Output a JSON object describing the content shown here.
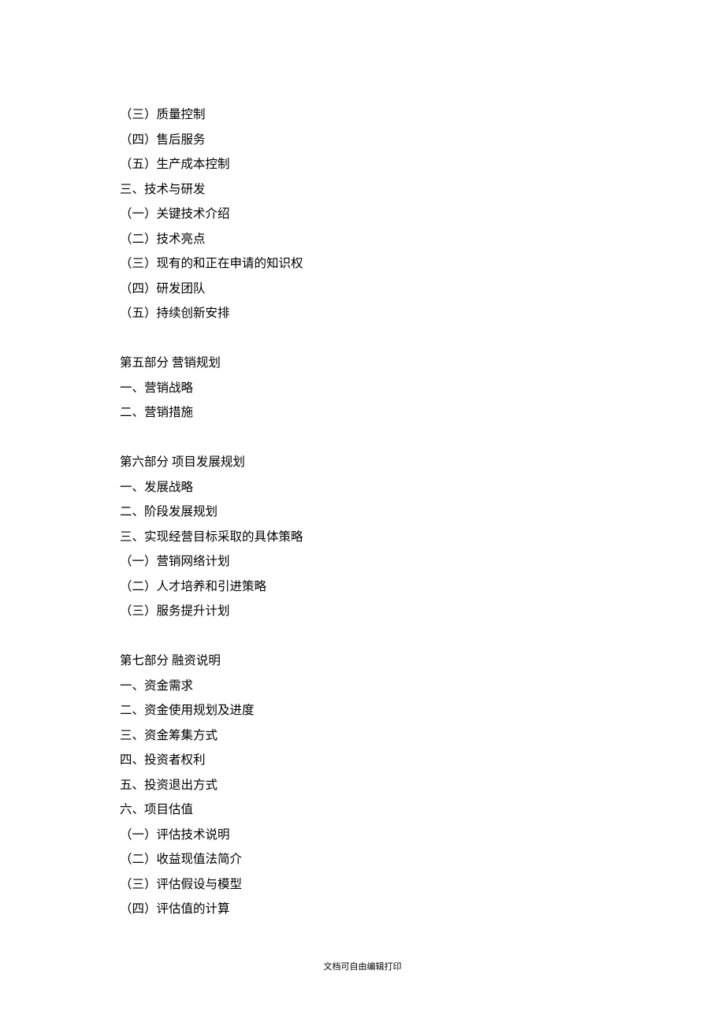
{
  "lines": [
    "（三）质量控制",
    "（四）售后服务",
    "（五）生产成本控制",
    "三、技术与研发",
    "（一）关键技术介绍",
    "（二）技术亮点",
    "（三）现有的和正在申请的知识权",
    "（四）研发团队",
    "（五）持续创新安排",
    "",
    "第五部分  营销规划",
    "一、营销战略",
    "二、营销措施",
    "",
    "第六部分  项目发展规划",
    "一、发展战略",
    "二、阶段发展规划",
    "三、实现经营目标采取的具体策略",
    "（一）营销网络计划",
    "（二）人才培养和引进策略",
    "（三）服务提升计划",
    "",
    "第七部分  融资说明",
    "一、资金需求",
    "二、资金使用规划及进度",
    "三、资金筹集方式",
    "四、投资者权利",
    "五、投资退出方式",
    "六、项目估值",
    "（一）评估技术说明",
    "（二）收益现值法简介",
    "（三）评估假设与模型",
    "（四）评估值的计算"
  ],
  "footer": "文档可自由编辑打印"
}
